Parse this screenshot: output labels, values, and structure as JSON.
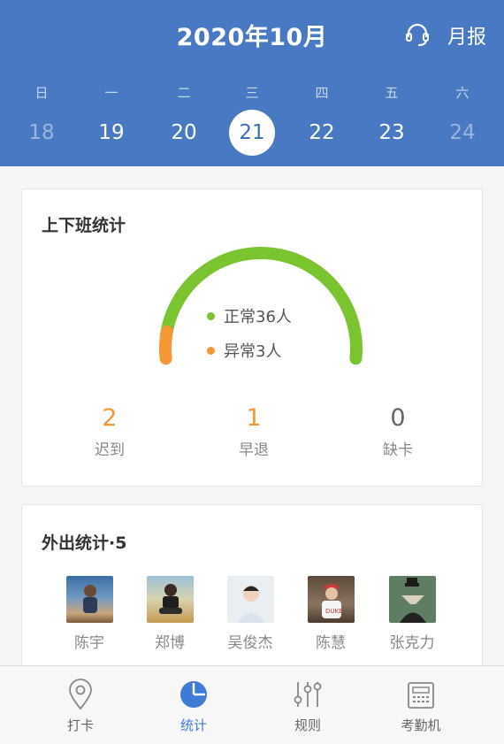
{
  "header": {
    "title": "2020年10月",
    "monthly_report": "月报",
    "weekdays": [
      "日",
      "一",
      "二",
      "三",
      "四",
      "五",
      "六"
    ],
    "days": [
      "18",
      "19",
      "20",
      "21",
      "22",
      "23",
      "24"
    ],
    "selected_day": "21"
  },
  "attendance": {
    "title": "上下班统计",
    "normal_label": "正常36人",
    "abnormal_label": "异常3人",
    "normal_color": "#7ac52f",
    "abnormal_color": "#f39835",
    "normal_count": 36,
    "abnormal_count": 3,
    "stats": [
      {
        "value": "2",
        "label": "迟到",
        "color": "#f39835"
      },
      {
        "value": "1",
        "label": "早退",
        "color": "#f39835"
      },
      {
        "value": "0",
        "label": "缺卡",
        "color": "#666666"
      }
    ]
  },
  "outing": {
    "title": "外出统计·5",
    "people": [
      "陈宇",
      "郑博",
      "吴俊杰",
      "陈慧",
      "张克力"
    ]
  },
  "tabs": [
    {
      "label": "打卡",
      "icon": "location-pin-icon"
    },
    {
      "label": "统计",
      "icon": "pie-chart-icon"
    },
    {
      "label": "规则",
      "icon": "sliders-icon"
    },
    {
      "label": "考勤机",
      "icon": "time-clock-icon"
    }
  ],
  "accent_color": "#4979c2",
  "active_tab_color": "#3d7bd6"
}
